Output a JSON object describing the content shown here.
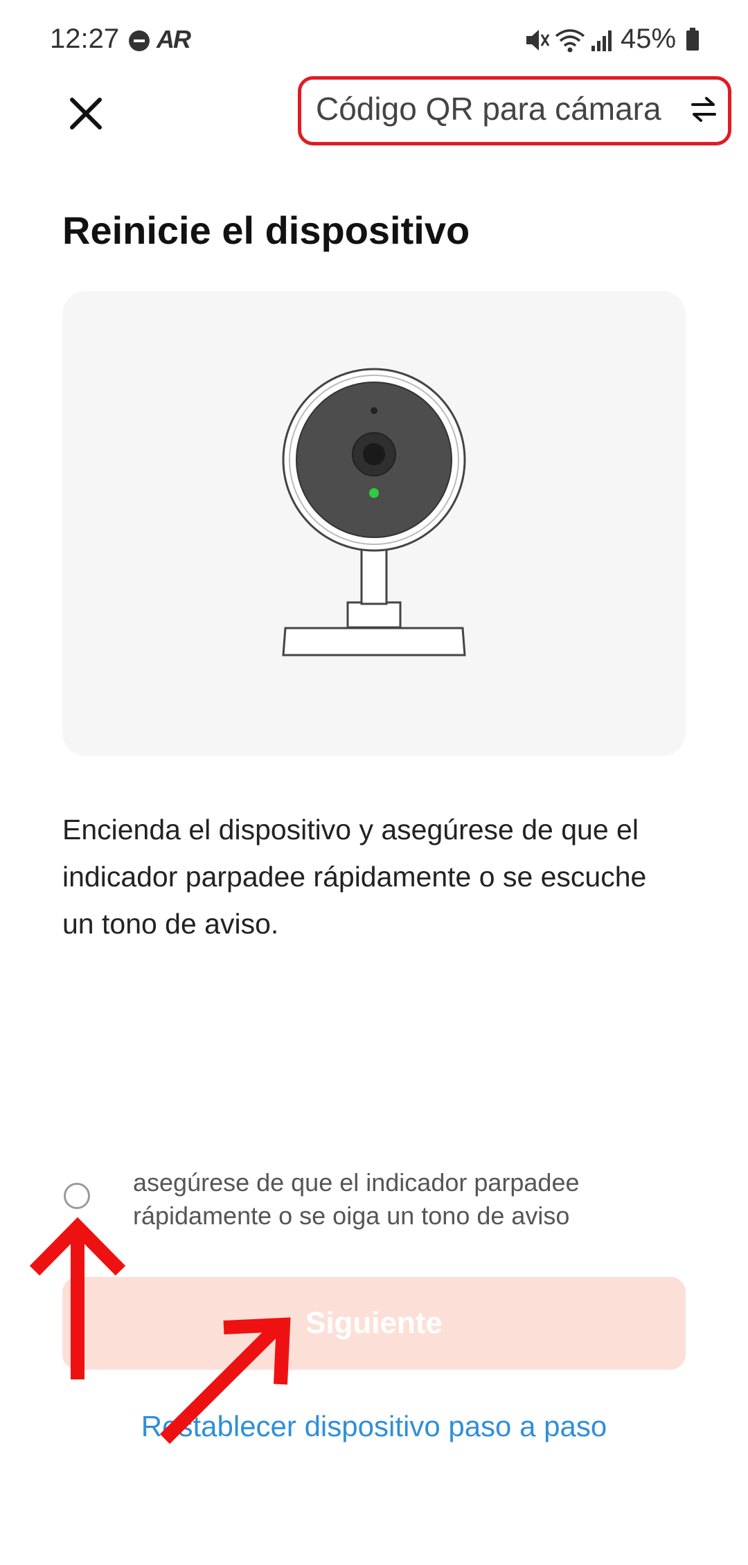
{
  "status_bar": {
    "time": "12:27",
    "ar_label": "AR",
    "battery": "45%",
    "icons": [
      "do-not-disturb-icon",
      "ar-icon",
      "mute-icon",
      "wifi-icon",
      "signal-icon",
      "battery-icon"
    ]
  },
  "header": {
    "close_icon": "close-icon",
    "qr_label": "Código QR para cámara",
    "swap_icon": "swap-icon"
  },
  "main": {
    "title": "Reinicie el dispositivo",
    "illustration": "security-camera",
    "instructions": "Encienda el dispositivo y asegúrese de que el indicador parpadee rápidamente o se escuche un tono de aviso."
  },
  "confirm": {
    "checked": false,
    "label": "asegúrese de que el indicador parpadee rápidamente o se oiga un tono de aviso"
  },
  "next_button": {
    "label": "Siguiente",
    "enabled": false
  },
  "reset_link": "Restablecer dispositivo paso a paso",
  "colors": {
    "highlight_box": "#e01b24",
    "annotation_arrows": "#ee1111",
    "button_disabled": "#fce0d8",
    "link": "#2f8fd8",
    "indicator_led": "#2ecc40"
  }
}
